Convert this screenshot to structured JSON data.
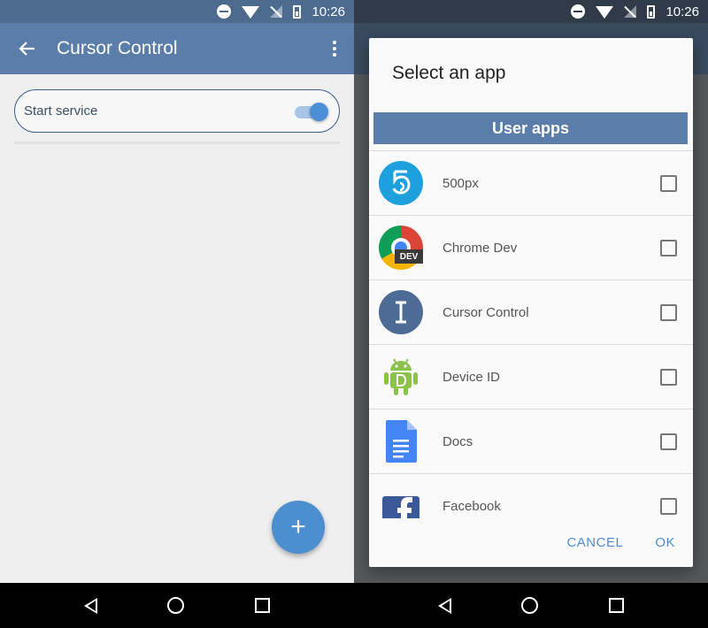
{
  "status_bar": {
    "time": "10:26"
  },
  "left": {
    "app_bar": {
      "title": "Cursor Control"
    },
    "service": {
      "label": "Start service",
      "enabled": true
    },
    "fab": {
      "label": "+"
    }
  },
  "right": {
    "dialog": {
      "title": "Select an app",
      "section_header": "User apps",
      "apps": [
        {
          "name": "500px",
          "icon": "500px-icon",
          "checked": false
        },
        {
          "name": "Chrome Dev",
          "icon": "chrome-dev-icon",
          "badge": "DEV",
          "checked": false
        },
        {
          "name": "Cursor Control",
          "icon": "cursor-control-icon",
          "checked": false
        },
        {
          "name": "Device ID",
          "icon": "android-icon",
          "checked": false
        },
        {
          "name": "Docs",
          "icon": "docs-icon",
          "checked": false
        },
        {
          "name": "Facebook",
          "icon": "facebook-icon",
          "checked": false
        }
      ],
      "cancel_label": "CANCEL",
      "ok_label": "OK"
    }
  },
  "colors": {
    "primary": "#5a7ea9",
    "accent": "#4c8fd1",
    "status_bar": "#4d6b8f"
  }
}
